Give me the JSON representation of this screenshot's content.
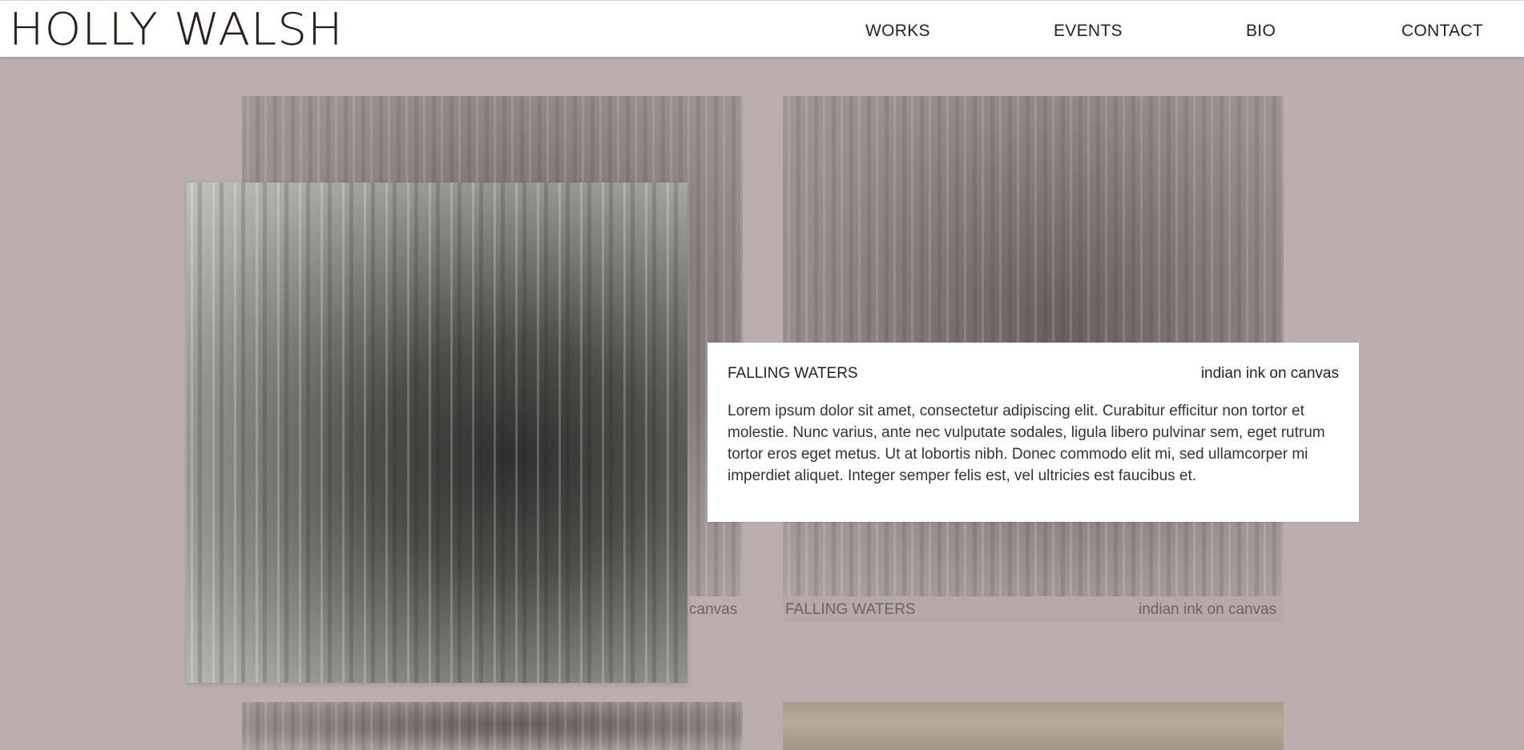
{
  "header": {
    "logo": "HOLLY WALSH",
    "nav": [
      "WORKS",
      "EVENTS",
      "BIO",
      "CONTACT"
    ]
  },
  "gallery": {
    "items": [
      {
        "title": "FALLING WATERS",
        "medium": "indian ink on canvas",
        "caption_visible": "canvas"
      },
      {
        "title": "FALLING WATERS",
        "medium": "indian ink on canvas"
      }
    ]
  },
  "detail": {
    "title": "FALLING WATERS",
    "medium": "indian ink on canvas",
    "description": "Lorem ipsum dolor sit amet, consectetur adipiscing elit. Curabitur efficitur non tortor et molestie. Nunc varius, ante nec vulputate sodales, ligula libero pulvinar sem, eget rutrum tortor eros eget metus. Ut at lobortis nibh. Donec commodo elit mi, sed ullamcorper mi imperdiet aliquet. Integer semper felis est, vel ultricies est faucibus et."
  },
  "colors": {
    "background": "#bcaeae",
    "header": "#ffffff",
    "text": "#2a1f1c"
  }
}
